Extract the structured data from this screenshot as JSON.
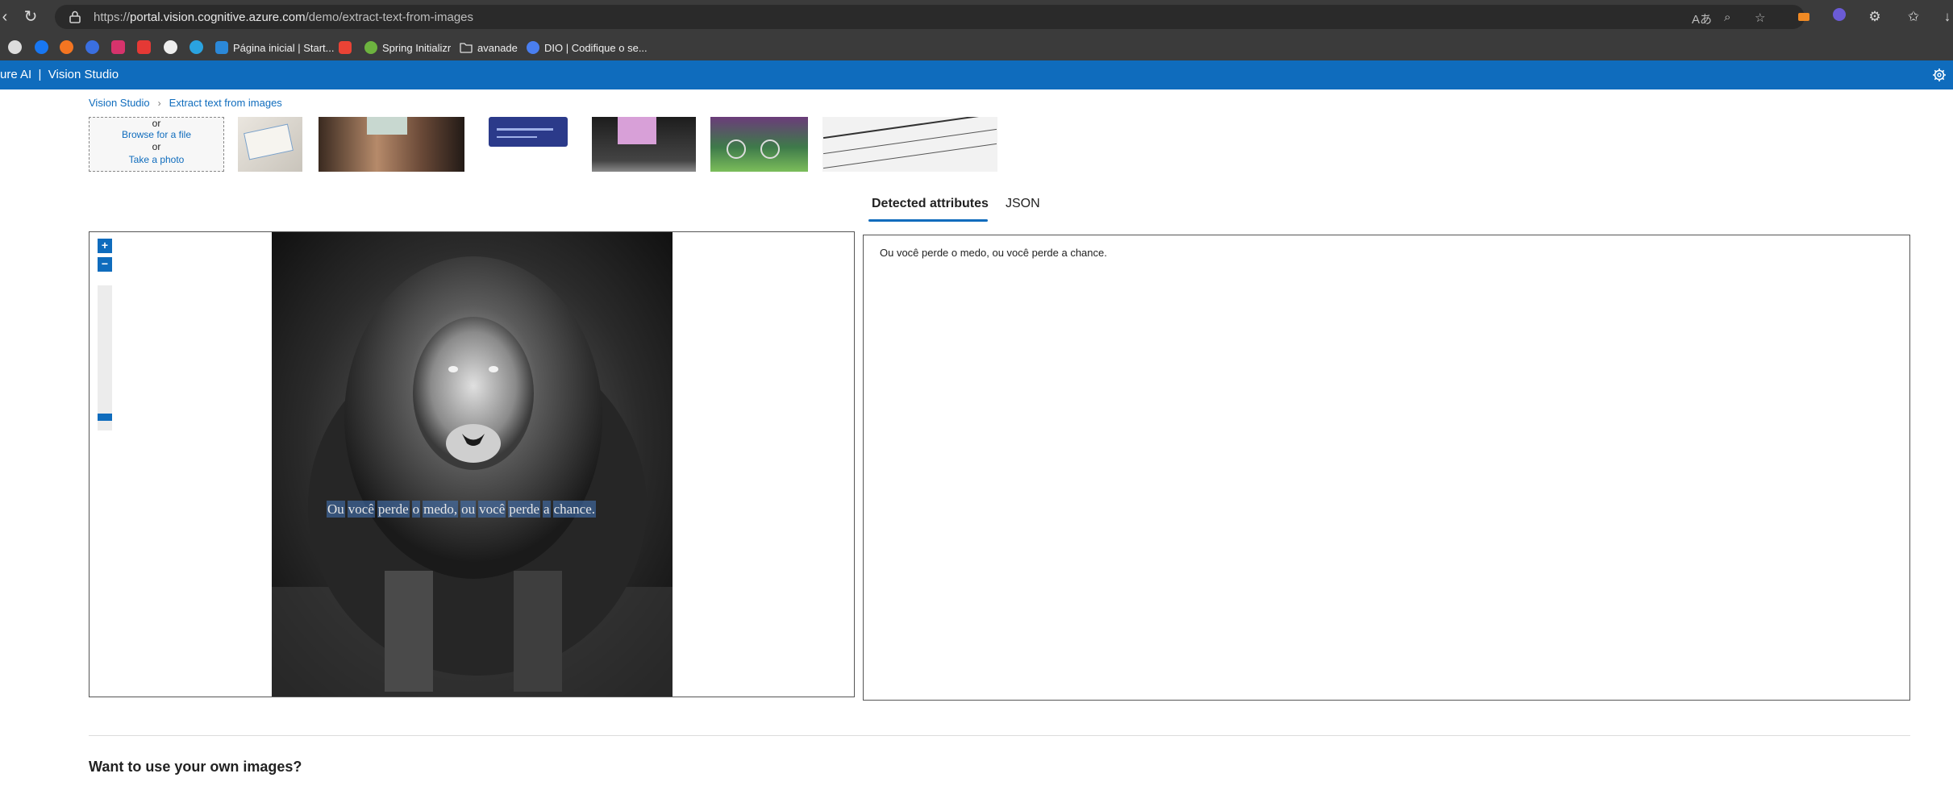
{
  "browser": {
    "url_scheme": "https://",
    "url_host": "portal.vision.cognitive.azure.com",
    "url_path": "/demo/extract-text-from-images"
  },
  "bookmarks": [
    {
      "label": "Página inicial | Start...",
      "icon": "bookmark-icon"
    },
    {
      "label": "Spring Initializr",
      "icon": "spring-icon"
    },
    {
      "label": "avanade",
      "icon": "folder-icon"
    },
    {
      "label": "DIO | Codifique o se...",
      "icon": "dio-icon"
    }
  ],
  "header": {
    "title": "ure AI  |  Vision Studio"
  },
  "breadcrumb": {
    "root": "Vision Studio",
    "current": "Extract text from images"
  },
  "upload": {
    "or_1": "or",
    "browse": "Browse for a file",
    "or_2": "or",
    "photo": "Take a photo"
  },
  "tabs": {
    "detected": "Detected attributes",
    "json": "JSON"
  },
  "image_panel": {
    "zoom_in": "+",
    "zoom_out": "−",
    "zoom_level": 0.93,
    "ocr_words": [
      "Ou",
      "você",
      "perde",
      "o",
      "medo,",
      "ou",
      "você",
      "perde",
      "a",
      "chance."
    ]
  },
  "results": {
    "text": "Ou você perde o medo, ou você perde a chance."
  },
  "section": {
    "heading": "Want to use your own images?"
  },
  "colors": {
    "azure_blue": "#0f6cbd",
    "chrome_dark": "#3b3b3b"
  }
}
